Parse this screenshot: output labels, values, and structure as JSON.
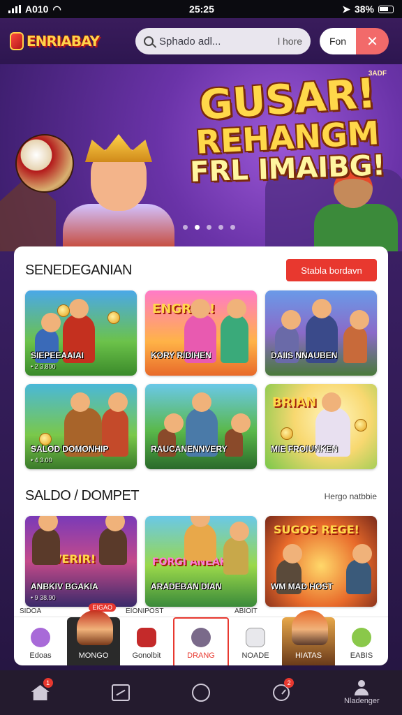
{
  "status_bar": {
    "carrier": "A010",
    "time": "25:25",
    "battery": "38%"
  },
  "header": {
    "logo_text": "ENRIABAY",
    "search_placeholder": "Sphado adl...",
    "search_hint": "l hore",
    "toggle_label": "Fon",
    "close_glyph": "✕"
  },
  "hero": {
    "line1": "GUSAR!",
    "line2": "REHANGM",
    "line3": "FRL IMAIBG!",
    "corner": "3ADF",
    "slide_count": 5,
    "active_slide": 1
  },
  "section1": {
    "title": "SENEDEGANIAN",
    "button_label": "Stabla bordavn",
    "cards": [
      {
        "caption": "SIEPEEAAIAI",
        "sub": "• 2 3.800",
        "banner": ""
      },
      {
        "caption": "KORY RIDIHEN",
        "sub": "",
        "banner": "ENGRER!"
      },
      {
        "caption": "DAIIS NNAUBEN",
        "sub": "",
        "banner": ""
      },
      {
        "caption": "SALOD DOMONHIP",
        "sub": "• 4 3.00",
        "banner": ""
      },
      {
        "caption": "RAUCANENNVERY",
        "sub": "",
        "banner": ""
      },
      {
        "caption": "MIE FROIUNKEN",
        "sub": "",
        "banner": "BRIAN"
      }
    ]
  },
  "section2": {
    "title": "SALDO / DOMPET",
    "link_label": "Hergo natbbie",
    "cards": [
      {
        "caption": "ANBKIV BGAKIA",
        "sub": "• 9 38.90",
        "banner": "VERIR!"
      },
      {
        "caption": "ARADEBAN DIAN",
        "sub": "",
        "banner": "FORGI ANEAKA"
      },
      {
        "caption": "WM MAD HOST",
        "sub": "",
        "banner": "SUGOS REGE!"
      }
    ]
  },
  "categories": [
    {
      "label": "Edoas",
      "tag": "SIDOA",
      "hot": ""
    },
    {
      "label": "MONGO",
      "tag": "",
      "hot": "EIGAO"
    },
    {
      "label": "Gonolbit",
      "tag": "EIONIPOST",
      "hot": ""
    },
    {
      "label": "DRANG",
      "tag": "",
      "hot": ""
    },
    {
      "label": "NOADE",
      "tag": "ABIOIT",
      "hot": ""
    },
    {
      "label": "HIATAS",
      "tag": "",
      "hot": ""
    },
    {
      "label": "EABIS",
      "tag": "",
      "hot": ""
    }
  ],
  "nav": [
    {
      "name": "home",
      "label": "",
      "badge": "1"
    },
    {
      "name": "chart",
      "label": "",
      "badge": ""
    },
    {
      "name": "circle",
      "label": "",
      "badge": ""
    },
    {
      "name": "history",
      "label": "",
      "badge": "2"
    },
    {
      "name": "profile",
      "label": "Nladenger",
      "badge": ""
    }
  ],
  "colors": {
    "accent": "#e8382f",
    "header_bg": "#2d1650",
    "nav_bg": "#241b2e",
    "title_yellow": "#ffd84a"
  }
}
